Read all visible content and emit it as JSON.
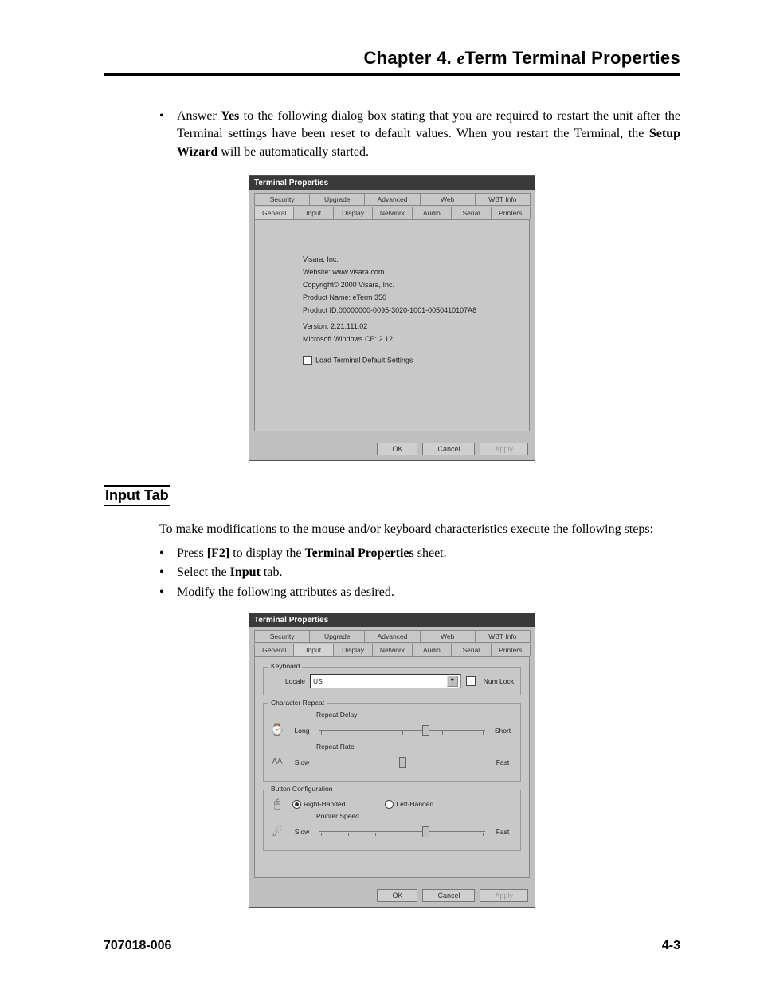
{
  "header": {
    "chapter_prefix": "Chapter 4.  ",
    "chapter_italic": "e",
    "chapter_rest": "Term Terminal Properties"
  },
  "intro_bullet": {
    "pre": "Answer ",
    "yes": "Yes",
    "mid": " to the following dialog box stating that you are required to restart the unit after the Terminal settings have been reset to default values. When you restart the Terminal, the ",
    "wizard": "Setup Wizard",
    "post": " will be automatically started."
  },
  "dlg1": {
    "title": "Terminal Properties",
    "tabs_row1": [
      "Security",
      "Upgrade",
      "Advanced",
      "Web",
      "WBT Info"
    ],
    "tabs_row2": [
      "General",
      "Input",
      "Display",
      "Network",
      "Audio",
      "Serial",
      "Printers"
    ],
    "active_tab": "General",
    "company": "Visara, Inc.",
    "website": "Website: www.visara.com",
    "copyright": "Copyright© 2000 Visara, Inc.",
    "product_name": "Product Name:  eTerm 350",
    "product_id": "Product ID:00000000-0095-3020-1001-0050410107A8",
    "version": "Version:  2.21.111.02",
    "wince": "Microsoft Windows CE:  2.12",
    "checkbox_label": "Load Terminal Default Settings",
    "ok": "OK",
    "cancel": "Cancel",
    "apply": "Apply"
  },
  "section_heading": "Input Tab",
  "para2": "To make modifications to the mouse and/or keyboard characteristics execute the following steps:",
  "bullets2": {
    "b1_pre": "Press ",
    "b1_key": "[F2]",
    "b1_mid": " to display the ",
    "b1_bold": "Terminal Properties",
    "b1_post": " sheet.",
    "b2_pre": "Select the ",
    "b2_bold": "Input",
    "b2_post": " tab.",
    "b3": "Modify the following attributes as desired."
  },
  "dlg2": {
    "title": "Terminal Properties",
    "tabs_row1": [
      "Security",
      "Upgrade",
      "Advanced",
      "Web",
      "WBT Info"
    ],
    "tabs_row2": [
      "General",
      "Input",
      "Display",
      "Network",
      "Audio",
      "Serial",
      "Printers"
    ],
    "active_tab": "Input",
    "grp_keyboard": "Keyboard",
    "locale_label": "Locale",
    "locale_value": "US",
    "numlock_label": "Num Lock",
    "grp_repeat": "Character Repeat",
    "repeat_delay": "Repeat Delay",
    "long": "Long",
    "short": "Short",
    "repeat_rate": "Repeat Rate",
    "slow": "Slow",
    "fast": "Fast",
    "grp_button": "Button Configuration",
    "right_handed": "Right-Handed",
    "left_handed": "Left-Handed",
    "pointer_speed": "Pointer Speed",
    "ok": "OK",
    "cancel": "Cancel",
    "apply": "Apply"
  },
  "footer": {
    "left": "707018-006",
    "right": "4-3"
  }
}
